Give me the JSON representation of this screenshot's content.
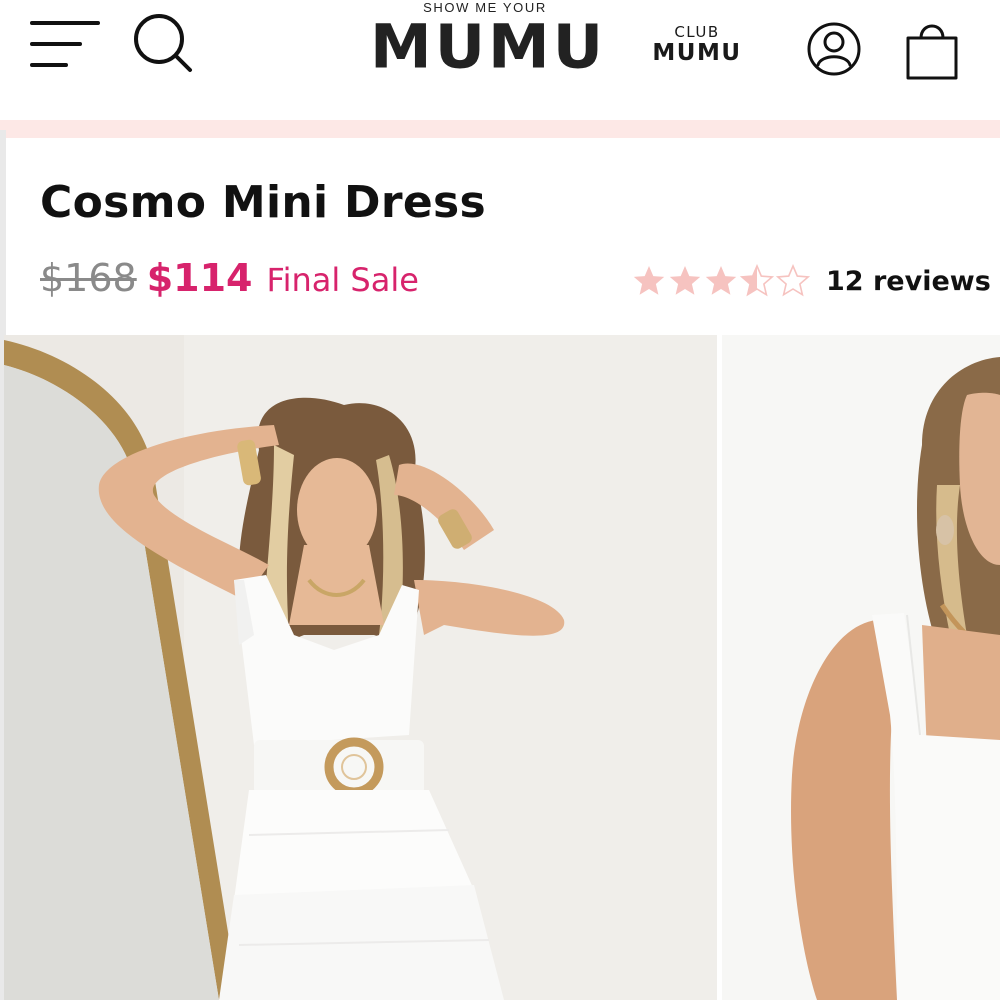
{
  "brand": {
    "tagline": "SHOW ME YOUR",
    "name": "MUMU"
  },
  "club": {
    "top": "CLUB",
    "bottom": "MUMU"
  },
  "icons": {
    "menu": "menu-icon",
    "search": "search-icon",
    "account": "account-icon",
    "bag": "shopping-bag-icon"
  },
  "product": {
    "title": "Cosmo Mini Dress",
    "price_original": "$168",
    "price_sale": "$114",
    "sale_label": "Final Sale",
    "rating": 3.5,
    "rating_max": 5,
    "reviews_text": "12 reviews"
  },
  "colors": {
    "sale": "#d7236c",
    "star": "#f6c3c0",
    "strip": "#fde8e6"
  },
  "gallery": {
    "images": [
      "product-photo-front",
      "product-photo-detail"
    ]
  }
}
